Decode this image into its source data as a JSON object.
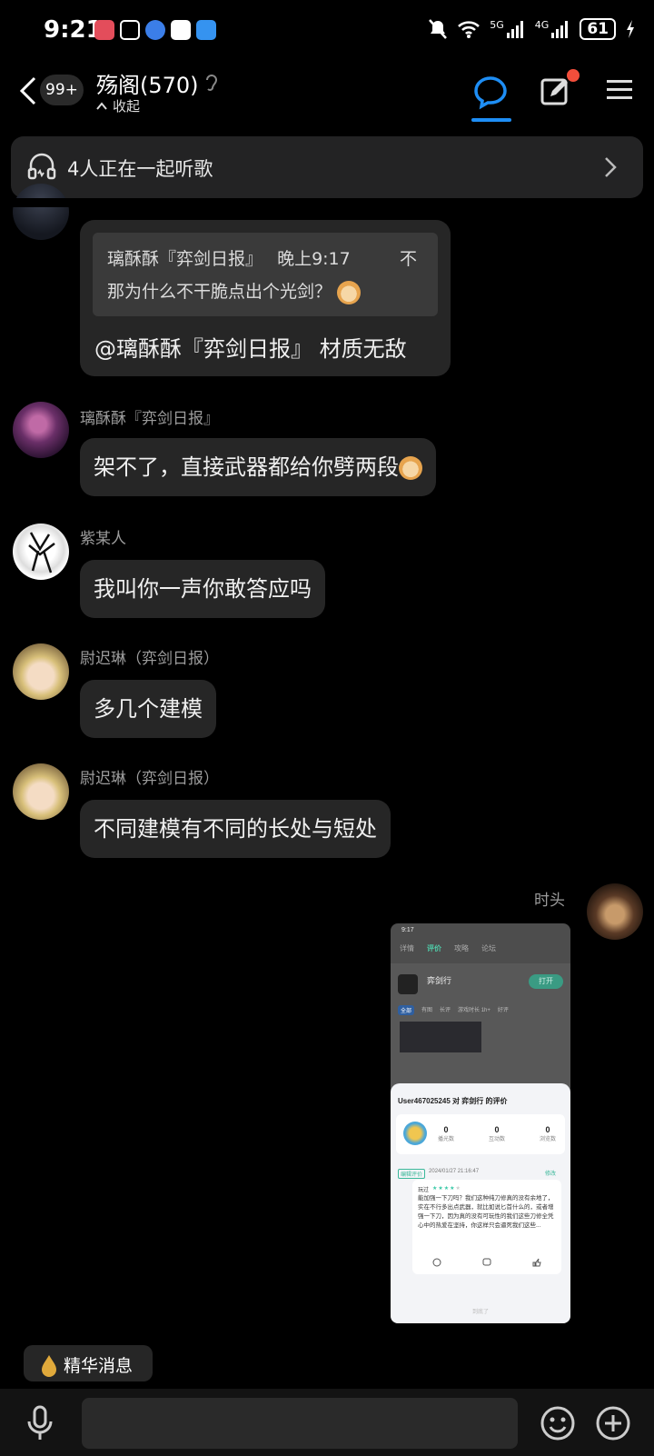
{
  "status_bar": {
    "time": "9:21",
    "network_1": "5G",
    "network_2": "4G",
    "battery": "61"
  },
  "header": {
    "unread_badge": "99+",
    "group_name": "殇阁(570)",
    "collapse_label": "收起",
    "active_tab": "chat",
    "accent_color": "#1e8ef5",
    "notification_dot_color": "#f24e3b"
  },
  "listen_bar": {
    "text": "4人正在一起听歌"
  },
  "messages": [
    {
      "quote": {
        "author": "璃酥酥『弈剑日报』",
        "time": "晚上9:17",
        "trailing": "不",
        "text": "那为什么不干脆点出个光剑？"
      },
      "text": "@璃酥酥『弈剑日报』 材质无敌"
    },
    {
      "sender": "璃酥酥『弈剑日报』",
      "text": "架不了，直接武器都给你劈两段"
    },
    {
      "sender": "紫某人",
      "text": "我叫你一声你敢答应吗"
    },
    {
      "sender": "尉迟琳（弈剑日报）",
      "text": "多几个建模"
    },
    {
      "sender": "尉迟琳（弈剑日报）",
      "text": "不同建模有不同的长处与短处"
    },
    {
      "sender": "时头",
      "screenshot": {
        "time": "9:17",
        "tabs": [
          "详情",
          "评价",
          "攻略",
          "论坛"
        ],
        "game_name": "弈剑行",
        "open_button": "打开",
        "filters": [
          "全部",
          "有图",
          "长评",
          "游戏时长 1h+",
          "好评"
        ],
        "card_title": "User467025245 对 弈剑行 的评价",
        "stats": [
          {
            "value": "0",
            "label": "播光数"
          },
          {
            "value": "0",
            "label": "互动数"
          },
          {
            "value": "0",
            "label": "浏览数"
          }
        ],
        "review_tag": "编辑评价",
        "review_date": "2024/01/27 21:16:47",
        "edit_label": "修改",
        "rating_label": "玩过",
        "rating": 4,
        "review_text": "能加强一下刀吗？我们这种纯刀修真的没有余地了，实在不行多出点武器，就比如说匕首什么的，或者增强一下刀，因为真的没有可玩性的我们这些刀修全凭心中的热爱在坚持，你这样只会逼死我们这些...",
        "footer": "到底了"
      }
    }
  ],
  "essence_button": {
    "label": "精华消息"
  }
}
